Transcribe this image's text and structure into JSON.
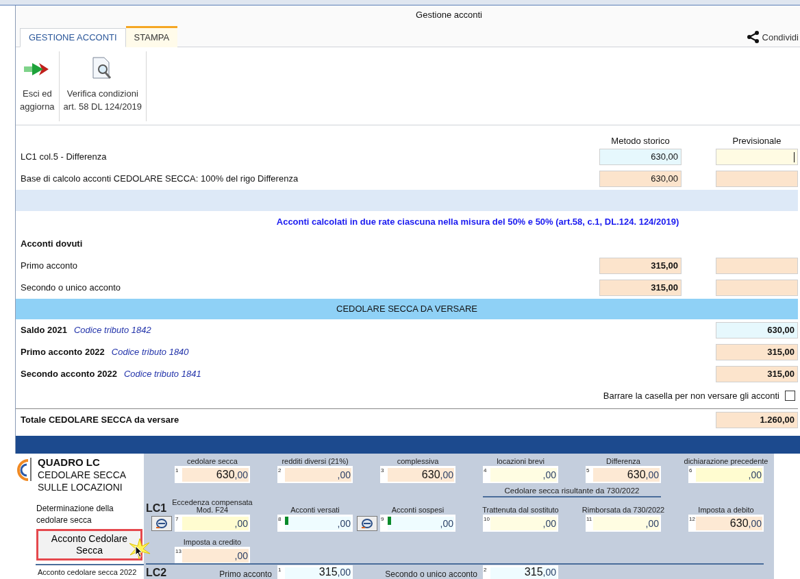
{
  "dialog": {
    "title": "Gestione acconti",
    "tabs": [
      {
        "label": "GESTIONE ACCONTI",
        "selected": true,
        "kind": "normal"
      },
      {
        "label": "STAMPA",
        "selected": false,
        "kind": "contextual"
      }
    ],
    "share": {
      "label": "Condividi"
    },
    "ribbon": [
      {
        "label_lines": [
          "Esci ed",
          "aggiorna"
        ],
        "kind": "exit"
      },
      {
        "label_lines": [
          "Verifica condizioni",
          "art. 58 DL 124/2019"
        ],
        "kind": "inspect"
      }
    ],
    "columns": [
      "Metodo storico",
      "Previsionale"
    ],
    "rows": [
      {
        "kind": "row",
        "label": "LC1 col.5 - Differenza",
        "fields": [
          {
            "value": "630,00",
            "color": "#e6f8fd",
            "bold": false,
            "focused": false
          },
          {
            "color": "#fffbe3",
            "focused": true
          }
        ]
      },
      {
        "kind": "row",
        "label": "Base di calcolo acconti CEDOLARE SECCA: 100% del rigo Differenza",
        "fields": [
          {
            "value": "630,00",
            "color": "#fce4cc",
            "bold": false,
            "focused": false
          },
          {
            "color": "#fce4cc",
            "focused": false
          }
        ]
      },
      {
        "kind": "band"
      },
      {
        "kind": "note",
        "label": "Acconti calcolati in due rate ciascuna nella misura del 50% e 50% (art.58, c.1, DL.124. 124/2019)"
      },
      {
        "kind": "heading",
        "label": "Acconti dovuti"
      },
      {
        "kind": "row",
        "label": "Primo acconto",
        "fields": [
          {
            "value": "315,00",
            "color": "#fce4cc",
            "bold": true,
            "focused": false
          },
          {
            "color": "#fce4cc",
            "focused": false
          }
        ]
      },
      {
        "kind": "row",
        "label": "Secondo o unico acconto",
        "fields": [
          {
            "value": "315,00",
            "color": "#fce4cc",
            "bold": true,
            "focused": false
          },
          {
            "color": "#fce4cc",
            "focused": false
          }
        ]
      },
      {
        "kind": "section",
        "label": "CEDOLARE SECCA DA VERSARE"
      },
      {
        "kind": "payment",
        "label": "Saldo 2021",
        "code": "Codice tributo 1842",
        "field": {
          "value": "630,00",
          "color": "#e6f8fd",
          "bold": true,
          "focused": false
        }
      },
      {
        "kind": "payment",
        "label": "Primo acconto 2022",
        "code": "Codice tributo 1840",
        "field": {
          "value": "315,00",
          "color": "#fce4cc",
          "bold": true,
          "focused": false
        }
      },
      {
        "kind": "payment",
        "label": "Secondo acconto 2022",
        "code": "Codice tributo 1841",
        "field": {
          "value": "315,00",
          "color": "#fce4cc",
          "bold": true,
          "focused": false
        }
      },
      {
        "kind": "checkbox",
        "label": "Barrare la casella per non versare gli acconti",
        "checked": false
      },
      {
        "kind": "total",
        "label": "Totale CEDOLARE SECCA da versare",
        "field": {
          "value": "1.260,00",
          "color": "#fce4cc",
          "bold": true,
          "focused": false
        }
      }
    ]
  },
  "form": {
    "title": "QUADRO LC",
    "subtitle_lines": [
      "CEDOLARE SECCA",
      "SULLE LOCAZIONI"
    ],
    "section_label": "Determinazione della cedolare secca",
    "button": {
      "label": "Acconto Cedolare Secca",
      "highlighted": true
    },
    "section2_label": "Acconto cedolare secca 2022",
    "lc1": {
      "code": "LC1",
      "group_title": "Cedolare secca risultante da 730/2022",
      "rows": [
        [
          {
            "number": "1",
            "label": "cedolare secca",
            "color": "#fde9d4",
            "integer": "630",
            "decimals": ",00",
            "marker": false
          },
          {
            "number": "2",
            "label": "redditi diversi (21%)",
            "color": "#fde9d4",
            "decimals": ",00",
            "marker": false
          },
          {
            "number": "3",
            "label": "complessiva",
            "color": "#fde9d4",
            "integer": "630",
            "decimals": ",00",
            "marker": false
          },
          {
            "number": "4",
            "label": "locazioni brevi",
            "color": "#fffde2",
            "decimals": ",00",
            "marker": false
          },
          {
            "number": "5",
            "label": "Differenza",
            "color": "#fde9d4",
            "integer": "630",
            "decimals": ",00",
            "marker": false
          },
          {
            "number": "6",
            "label": "dichiarazione precedente",
            "color": "#fffcd0",
            "decimals": ",00",
            "marker": false
          }
        ],
        [
          {
            "number": "7",
            "label": "Eccedenza compensata Mod. F24",
            "color": "#fffcd0",
            "decimals": ",00",
            "marker": false,
            "calc_button": true
          },
          {
            "number": "8",
            "label": "Acconti versati",
            "color": "#effcff",
            "decimals": ",00",
            "marker": true
          },
          {
            "number": "9",
            "label": "Acconti sospesi",
            "color": "#effcff",
            "decimals": ",00",
            "marker": true,
            "calc_button": true
          },
          {
            "number": "10",
            "label": "Trattenuta dal sostituto",
            "color": "#fffde2",
            "decimals": ",00",
            "marker": false
          },
          {
            "number": "11",
            "label": "Rimborsata da 730/2022",
            "color": "#fffde2",
            "decimals": ",00",
            "marker": false
          },
          {
            "number": "12",
            "label": "Imposta a debito",
            "color": "#fde9d4",
            "integer": "630",
            "decimals": ",00",
            "marker": false
          }
        ],
        [
          {
            "number": "13",
            "label": "Imposta a credito",
            "color": "#fde9d4",
            "decimals": ",00",
            "marker": false
          }
        ]
      ]
    },
    "lc2": {
      "code": "LC2",
      "fields": [
        {
          "number": "1",
          "label": "Primo acconto",
          "color": "#effcff",
          "integer": "315",
          "decimals": ",00"
        },
        {
          "number": "2",
          "label": "Secondo o unico acconto",
          "color": "#effcff",
          "integer": "315",
          "decimals": ",00"
        }
      ]
    }
  }
}
